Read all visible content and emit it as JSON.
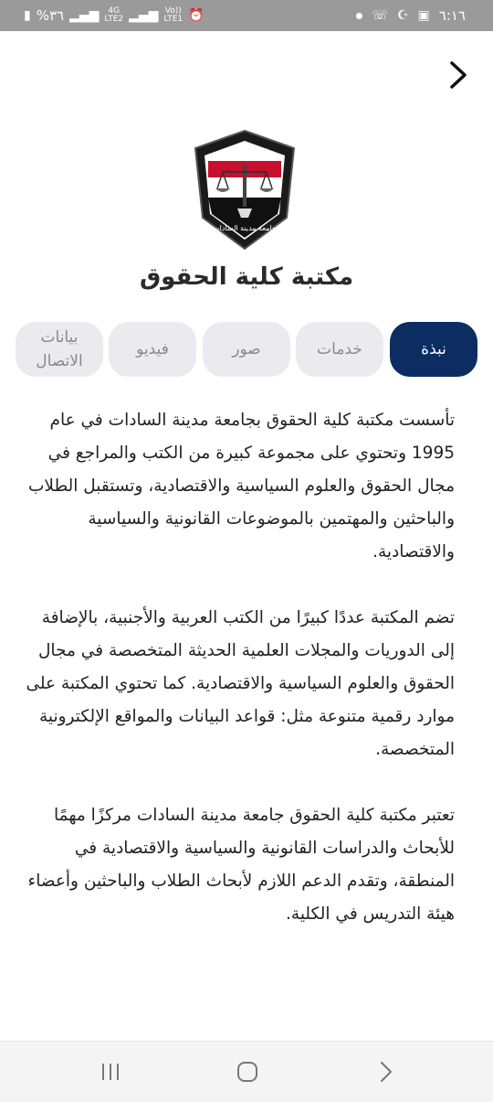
{
  "status_bar": {
    "time": "٦:١٦",
    "battery": "%٣٦",
    "network_1_top": "4G",
    "network_1_bottom": "LTE2",
    "network_2_top": "Vo))",
    "network_2_bottom": "LTE1"
  },
  "logo": {
    "top_text": "كلية الحقوق",
    "bottom_text": "جامعة مدينة السادات"
  },
  "page": {
    "title": "مكتبة كلية الحقوق"
  },
  "tabs": [
    {
      "label": "نبذة",
      "active": true
    },
    {
      "label": "خدمات",
      "active": false
    },
    {
      "label": "صور",
      "active": false
    },
    {
      "label": "فيديو",
      "active": false
    },
    {
      "label": "بيانات الاتصال",
      "active": false
    }
  ],
  "content": {
    "paragraphs": [
      "تأسست مكتبة كلية الحقوق بجامعة مدينة السادات في عام 1995 وتحتوي على مجموعة كبيرة من الكتب والمراجع في مجال الحقوق والعلوم السياسية والاقتصادية، وتستقبل الطلاب والباحثين والمهتمين بالموضوعات القانونية والسياسية والاقتصادية.",
      "تضم المكتبة عددًا كبيرًا من الكتب العربية والأجنبية، بالإضافة إلى الدوريات والمجلات العلمية الحديثة المتخصصة في مجال الحقوق والعلوم السياسية والاقتصادية. كما تحتوي المكتبة على موارد رقمية متنوعة مثل: قواعد البيانات والمواقع الإلكترونية المتخصصة.",
      "تعتبر مكتبة كلية الحقوق جامعة مدينة السادات مركزًا مهمًا للأبحاث والدراسات القانونية والسياسية والاقتصادية في المنطقة، وتقدم الدعم اللازم لأبحاث الطلاب والباحثين وأعضاء هيئة التدريس في الكلية."
    ]
  },
  "colors": {
    "accent": "#0c2d62",
    "tab_inactive_bg": "#ebebef",
    "tab_inactive_text": "#8a8a8a",
    "status_bar_bg": "#9a9a9a"
  },
  "icons": {
    "back": "chevron-right-icon",
    "nav_recents": "recents-icon",
    "nav_home": "home-icon",
    "nav_back": "nav-back-icon"
  }
}
